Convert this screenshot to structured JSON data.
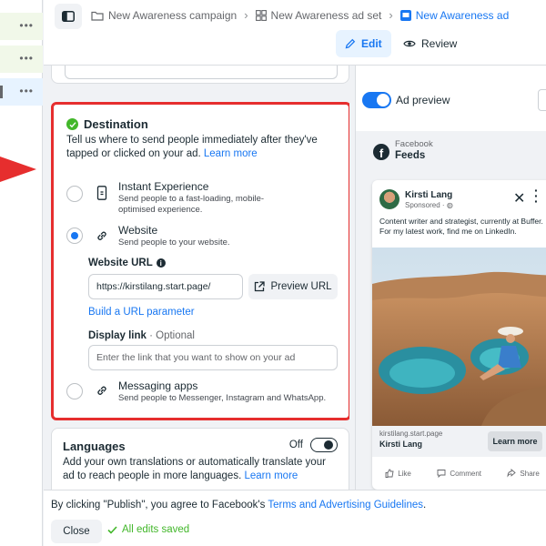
{
  "breadcrumb": {
    "campaign": "New Awareness campaign",
    "ad_set": "New Awareness ad set",
    "ad": "New Awareness ad"
  },
  "modes": {
    "edit": "Edit",
    "review": "Review"
  },
  "destination": {
    "title": "Destination",
    "description": "Tell us where to send people immediately after they've tapped or clicked on your ad.",
    "learn_more": "Learn more",
    "options": [
      {
        "title": "Instant Experience",
        "description": "Send people to a fast-loading, mobile-optimised experience.",
        "selected": false
      },
      {
        "title": "Website",
        "description": "Send people to your website.",
        "selected": true
      },
      {
        "title": "Messaging apps",
        "description": "Send people to Messenger, Instagram and WhatsApp.",
        "selected": false
      }
    ],
    "website_url_label": "Website URL",
    "website_url_value": "https://kirstilang.start.page/",
    "preview_url_label": "Preview URL",
    "url_parameter_link": "Build a URL parameter",
    "display_link_label": "Display link",
    "display_link_optional": " · Optional",
    "display_link_placeholder": "Enter the link that you want to show on your ad"
  },
  "languages": {
    "title": "Languages",
    "toggle_label": "Off",
    "description": "Add your own translations or automatically translate your ad to reach people in more languages.",
    "learn_more": "Learn more"
  },
  "preview": {
    "toggle_label": "Ad preview",
    "platform": "Facebook",
    "placement": "Feeds",
    "post": {
      "name": "Kirsti Lang",
      "sponsored": "Sponsored · ",
      "text": "Content writer and strategist, currently at Buffer. For my latest work, find me on LinkedIn.",
      "link_domain": "kirstilang.start.page",
      "link_title": "Kirsti Lang",
      "cta": "Learn more",
      "actions": [
        "Like",
        "Comment",
        "Share"
      ]
    }
  },
  "footer": {
    "publish_note_prefix": "By clicking \"Publish\", you agree to Facebook's ",
    "publish_note_link": "Terms and Advertising Guidelines",
    "publish_note_suffix": ".",
    "close_label": "Close",
    "saved_label": "All edits saved"
  },
  "colors": {
    "accent": "#1877f2",
    "highlight": "#e62e2e",
    "success": "#42b72a"
  }
}
